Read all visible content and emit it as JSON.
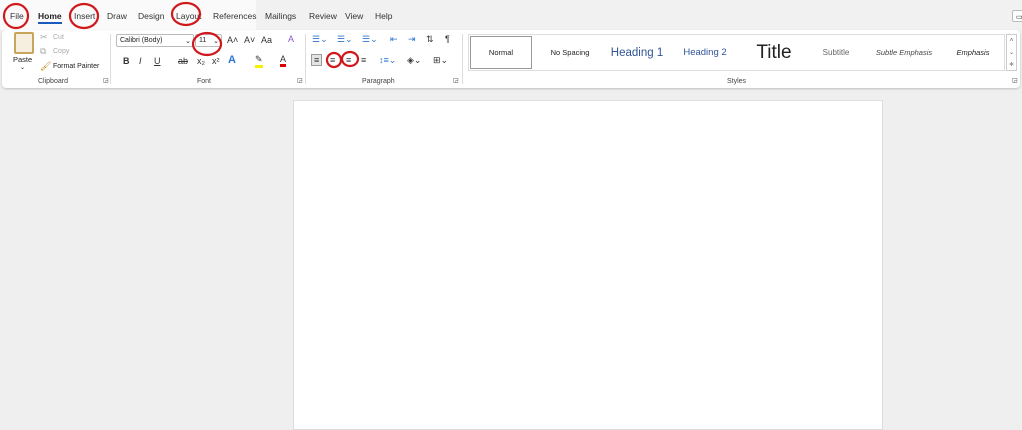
{
  "tabs": [
    "File",
    "Home",
    "Insert",
    "Draw",
    "Design",
    "Layout",
    "References",
    "Mailings",
    "Review",
    "View",
    "Help"
  ],
  "clipboard": {
    "paste": "Paste",
    "cut": "Cut",
    "copy": "Copy",
    "format_painter": "Format Painter",
    "label": "Clipboard"
  },
  "font": {
    "name": "Calibri (Body)",
    "size": "11",
    "label": "Font",
    "bold": "B",
    "italic": "I",
    "underline": "U",
    "strike": "ab",
    "subscript": "x₂",
    "superscript": "x²",
    "grow": "A˄",
    "shrink": "A˅",
    "case": "Aa"
  },
  "paragraph": {
    "label": "Paragraph"
  },
  "styles": {
    "label": "Styles",
    "items": [
      "Normal",
      "No Spacing",
      "Heading 1",
      "Heading 2",
      "Title",
      "Subtitle",
      "Subtle Emphasis",
      "Emphasis"
    ]
  },
  "colors": {
    "accent": "#185abd",
    "annotation": "#d0181c",
    "heading": "#2f5496"
  }
}
